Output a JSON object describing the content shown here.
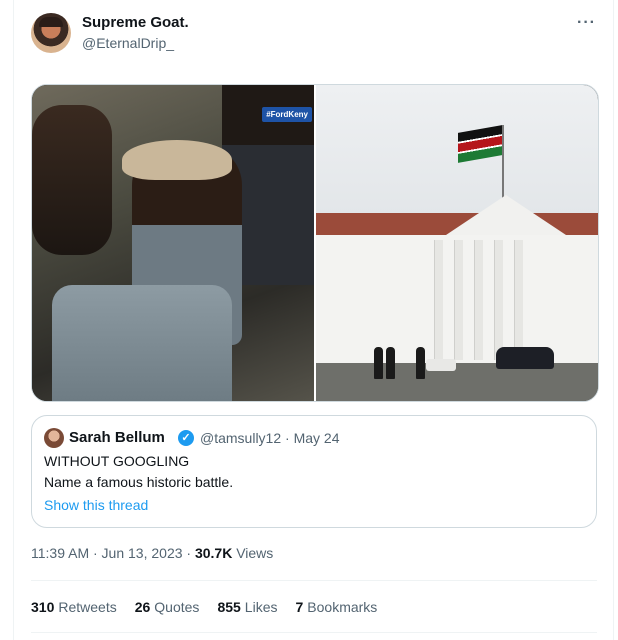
{
  "tweet": {
    "author_name": "Supreme Goat.",
    "author_handle": "@EternalDrip_",
    "more_icon": "more-horizontal-icon",
    "media": {
      "left_overlay_tag": "#FordKeny"
    },
    "quote": {
      "name": "Sarah Bellum",
      "handle_date": "@tamsully12 · May 24",
      "line1": "WITHOUT GOOGLING",
      "line2": "Name a famous historic battle.",
      "show_thread": "Show this thread"
    },
    "timestamp": "11:39 AM · Jun 13, 2023 · ",
    "views_count": "30.7K",
    "views_label": " Views",
    "stats": {
      "retweets_count": "310",
      "retweets_label": "Retweets",
      "quotes_count": "26",
      "quotes_label": "Quotes",
      "likes_count": "855",
      "likes_label": "Likes",
      "bookmarks_count": "7",
      "bookmarks_label": "Bookmarks"
    }
  },
  "colors": {
    "link": "#1d9bf0",
    "secondary_text": "#536471",
    "primary_text": "#0f1419",
    "border": "#cfd9de"
  }
}
